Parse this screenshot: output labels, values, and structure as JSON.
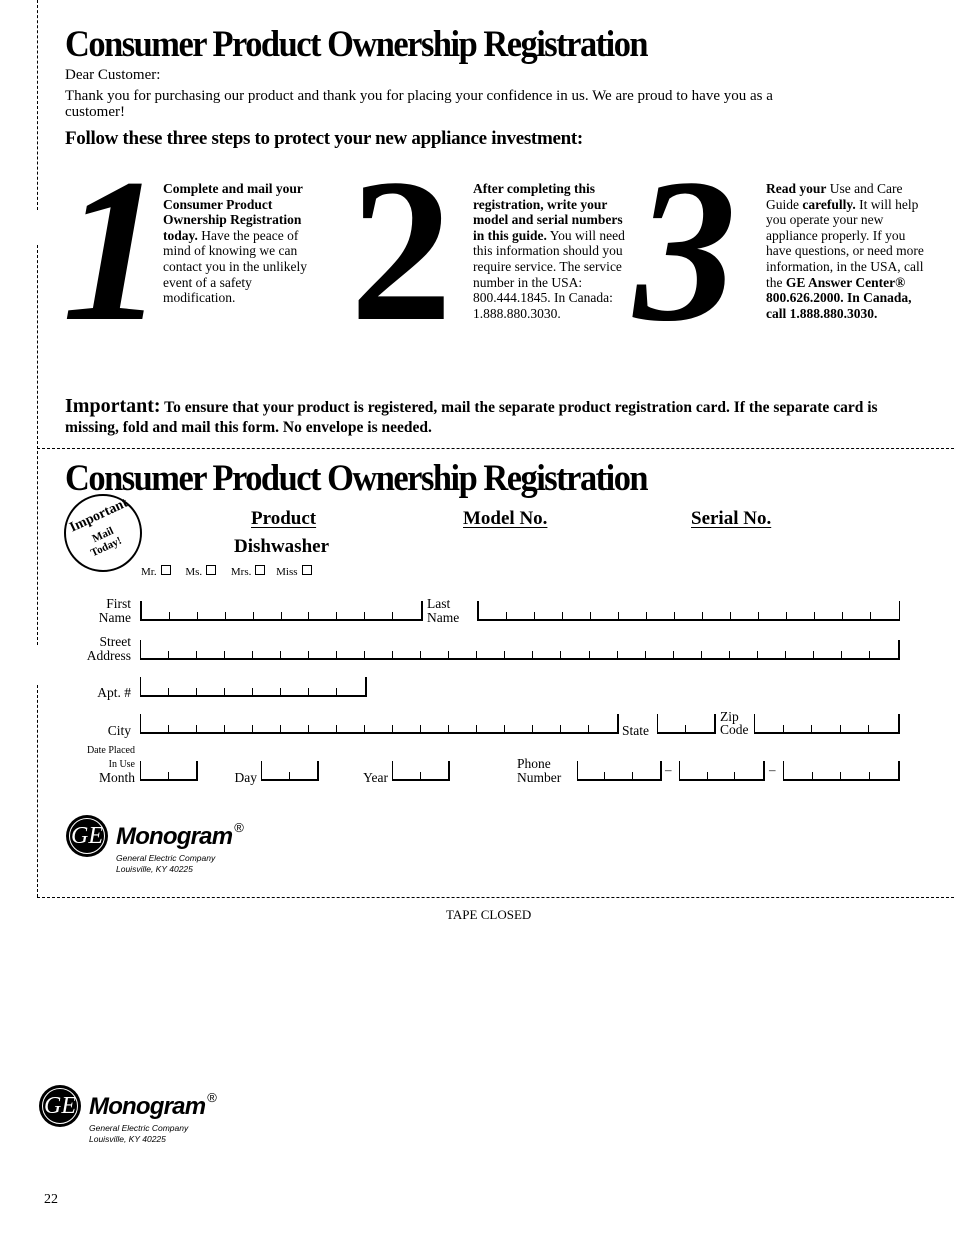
{
  "page": {
    "title": "Consumer Product Ownership Registration",
    "greeting": "Dear Customer:",
    "intro": "Thank you for purchasing our product and thank you for placing your confidence in us. We are proud to have you as a customer!",
    "steps_heading": "Follow these three steps to protect your new appliance investment:",
    "page_number": "22"
  },
  "steps": [
    {
      "number": "1",
      "bold_text": "Complete and mail your Consumer Product Ownership Registration today.",
      "text": " Have the peace of mind of knowing we can contact you in the unlikely event of a safety modification."
    },
    {
      "number": "2",
      "bold_text": "After completing this registration, write your model and serial numbers in this guide.",
      "text": " You will need this information should you require service. The service number in the USA: 800.444.1845. In Canada: 1.888.880.3030."
    },
    {
      "number": "3",
      "bold_a": "Read your",
      "text_a": " Use and Care Guide ",
      "bold_b": "carefully.",
      "text_b": " It will help you operate your new appliance properly. If you have questions, or need more information, in the USA, call the ",
      "bold_c": "GE Answer Center® 800.626.2000. In Canada, call 1.888.880.3030."
    }
  ],
  "important": {
    "label": "Important:",
    "text": "To ensure that your product is registered, mail the separate product registration card. If the separate card is missing, fold and mail this form. No envelope is needed."
  },
  "form": {
    "title": "Consumer Product Ownership Registration",
    "stamp": {
      "line1": "Important",
      "line2": "Mail",
      "line3": "Today!"
    },
    "product_header": "Product",
    "product_value": "Dishwasher",
    "model_header": "Model No.",
    "serial_header": "Serial No.",
    "salutations": [
      "Mr.",
      "Ms.",
      "Mrs.",
      "Miss"
    ],
    "fields": {
      "first_name": {
        "label1": "First",
        "label2": "Name",
        "cells": 10
      },
      "last_name": {
        "label1": "Last",
        "label2": "Name",
        "cells": 15
      },
      "street": {
        "label1": "Street",
        "label2": "Address",
        "cells": 27
      },
      "apt": {
        "label": "Apt. #",
        "cells": 8
      },
      "city": {
        "label": "City",
        "cells": 17
      },
      "state": {
        "label": "State",
        "cells": 2
      },
      "zip": {
        "label1": "Zip",
        "label2": "Code",
        "cells": 5
      },
      "date_placed": {
        "label1": "Date Placed",
        "label2": "In Use"
      },
      "month": {
        "label": "Month",
        "cells": 2
      },
      "day": {
        "label": "Day",
        "cells": 2
      },
      "year": {
        "label": "Year",
        "cells": 2
      },
      "phone": {
        "label1": "Phone",
        "label2": "Number",
        "cells": [
          3,
          3,
          4
        ],
        "separator": "–"
      }
    }
  },
  "logo": {
    "emblem": "ge-monogram-emblem",
    "emblem_text": "GE",
    "brand": "Monogram",
    "registered": "®",
    "company": "General Electric Company",
    "address": "Louisville, KY 40225"
  },
  "tape_label": "TAPE CLOSED"
}
